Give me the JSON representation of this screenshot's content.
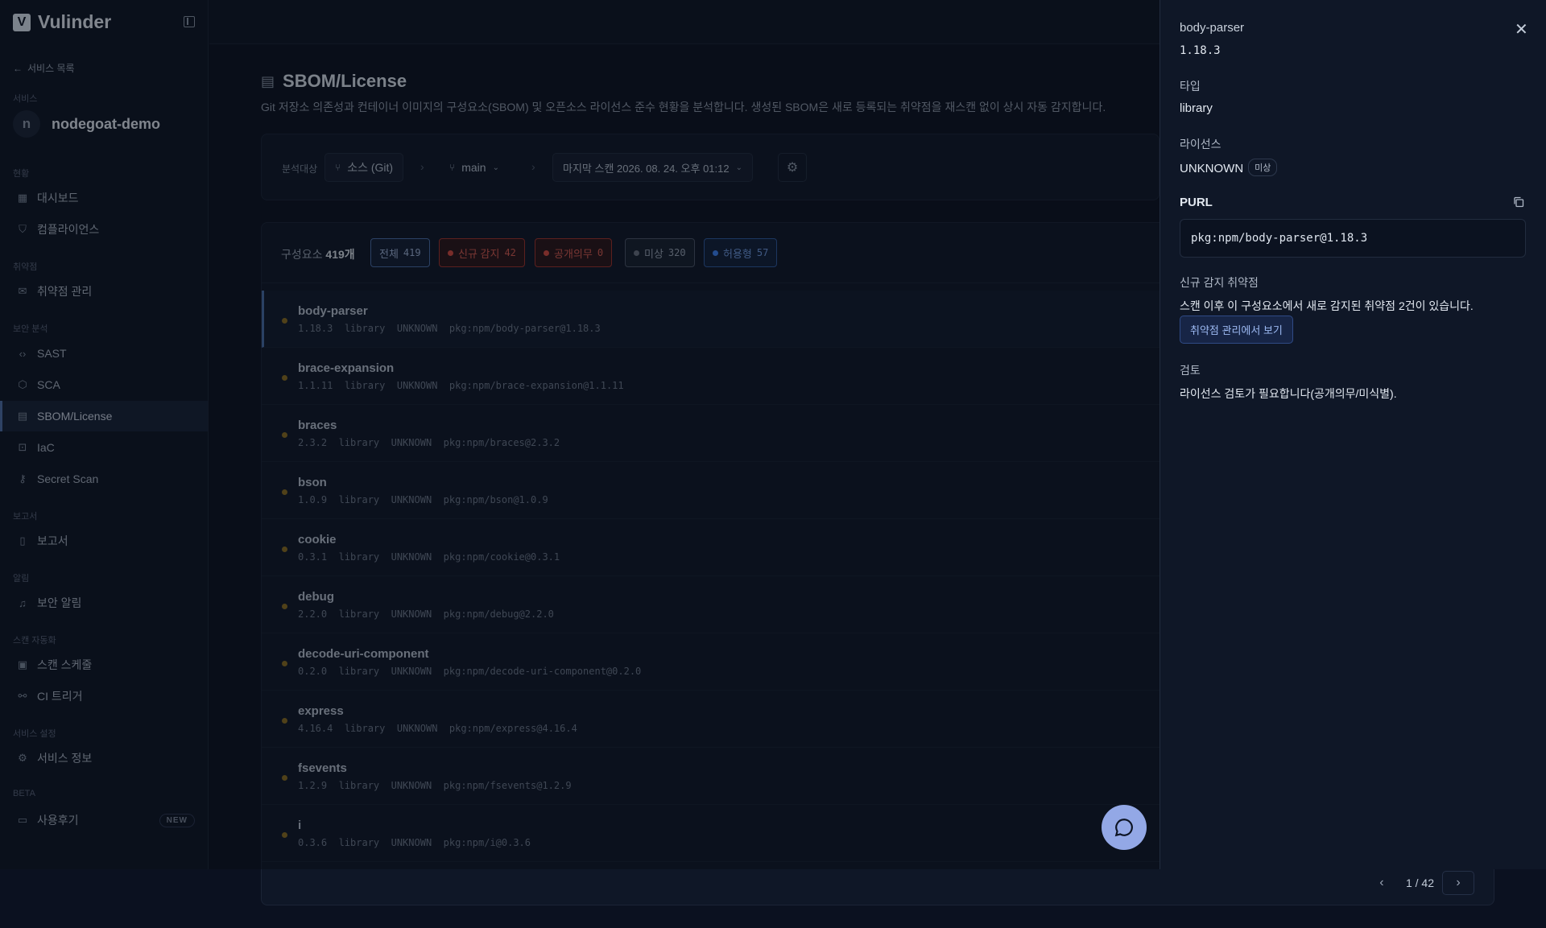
{
  "sidebar": {
    "brand_letter": "V",
    "brand": "Vulinder",
    "back_label": "서비스 목록",
    "service_section": "서비스",
    "service_initial": "n",
    "service_name": "nodegoat-demo",
    "sections": [
      {
        "label": "현황",
        "items": [
          {
            "label": "대시보드",
            "icon": "dashboard-icon"
          },
          {
            "label": "컴플라이언스",
            "icon": "shield-icon"
          }
        ]
      },
      {
        "label": "취약점",
        "items": [
          {
            "label": "취약점 관리",
            "icon": "inbox-icon"
          }
        ]
      },
      {
        "label": "보안 분석",
        "items": [
          {
            "label": "SAST",
            "icon": "code-icon"
          },
          {
            "label": "SCA",
            "icon": "package-icon"
          },
          {
            "label": "SBOM/License",
            "icon": "clipboard-icon"
          },
          {
            "label": "IaC",
            "icon": "scan-icon"
          },
          {
            "label": "Secret Scan",
            "icon": "key-icon"
          }
        ]
      },
      {
        "label": "보고서",
        "items": [
          {
            "label": "보고서",
            "icon": "file-icon"
          }
        ]
      },
      {
        "label": "알림",
        "items": [
          {
            "label": "보안 알림",
            "icon": "bell-icon"
          }
        ]
      },
      {
        "label": "스캔 자동화",
        "items": [
          {
            "label": "스캔 스케줄",
            "icon": "calendar-icon"
          },
          {
            "label": "CI 트리거",
            "icon": "webhook-icon"
          }
        ]
      },
      {
        "label": "서비스 설정",
        "items": [
          {
            "label": "서비스 정보",
            "icon": "gear-icon"
          }
        ]
      },
      {
        "label": "BETA",
        "items": [
          {
            "label": "사용후기",
            "icon": "feedback-icon",
            "badge": "NEW"
          }
        ]
      }
    ]
  },
  "main": {
    "title": "SBOM/License",
    "description": "Git 저장소 의존성과 컨테이너 이미지의 구성요소(SBOM) 및 오픈소스 라이선스 준수 현황을 분석합니다. 생성된 SBOM은 새로 등록되는 취약점을 재스캔 없이 상시 자동 감지합니다.",
    "filter_label": "분석대상",
    "source": "소스 (Git)",
    "branch": "main",
    "last_scan": "마지막 스캔 2026. 08. 24. 오후 01:12",
    "count_prefix": "구성요소",
    "count_value": "419개",
    "filters": [
      {
        "label": "전체",
        "count": "419"
      },
      {
        "label": "신규 감지",
        "count": "42"
      },
      {
        "label": "공개의무",
        "count": "0"
      },
      {
        "label": "미상",
        "count": "320"
      },
      {
        "label": "허용형",
        "count": "57"
      }
    ],
    "rows": [
      {
        "name": "body-parser",
        "version": "1.18.3",
        "type": "library",
        "license": "UNKNOWN",
        "purl": "pkg:npm/body-parser@1.18.3"
      },
      {
        "name": "brace-expansion",
        "version": "1.1.11",
        "type": "library",
        "license": "UNKNOWN",
        "purl": "pkg:npm/brace-expansion@1.1.11"
      },
      {
        "name": "braces",
        "version": "2.3.2",
        "type": "library",
        "license": "UNKNOWN",
        "purl": "pkg:npm/braces@2.3.2"
      },
      {
        "name": "bson",
        "version": "1.0.9",
        "type": "library",
        "license": "UNKNOWN",
        "purl": "pkg:npm/bson@1.0.9"
      },
      {
        "name": "cookie",
        "version": "0.3.1",
        "type": "library",
        "license": "UNKNOWN",
        "purl": "pkg:npm/cookie@0.3.1"
      },
      {
        "name": "debug",
        "version": "2.2.0",
        "type": "library",
        "license": "UNKNOWN",
        "purl": "pkg:npm/debug@2.2.0"
      },
      {
        "name": "decode-uri-component",
        "version": "0.2.0",
        "type": "library",
        "license": "UNKNOWN",
        "purl": "pkg:npm/decode-uri-component@0.2.0"
      },
      {
        "name": "express",
        "version": "4.16.4",
        "type": "library",
        "license": "UNKNOWN",
        "purl": "pkg:npm/express@4.16.4"
      },
      {
        "name": "fsevents",
        "version": "1.2.9",
        "type": "library",
        "license": "UNKNOWN",
        "purl": "pkg:npm/fsevents@1.2.9"
      },
      {
        "name": "i",
        "version": "0.3.6",
        "type": "library",
        "license": "UNKNOWN",
        "purl": "pkg:npm/i@0.3.6"
      }
    ],
    "pager": "1 / 42"
  },
  "drawer": {
    "name": "body-parser",
    "version": "1.18.3",
    "type_label": "타입",
    "type_value": "library",
    "license_label": "라이선스",
    "license_value": "UNKNOWN",
    "license_badge": "미상",
    "purl_label": "PURL",
    "purl_value": "pkg:npm/body-parser@1.18.3",
    "new_vuln_label": "신규 감지 취약점",
    "new_vuln_text": "스캔 이후 이 구성요소에서 새로 감지된 취약점 2건이 있습니다.",
    "vuln_button": "취약점 관리에서 보기",
    "review_label": "검토",
    "review_text": "라이선스 검토가 필요합니다(공개의무/미식별)."
  },
  "colors": {
    "accent": "#4a6da8",
    "new_detect": "#c0392b",
    "unknown": "#6b7280",
    "permissive": "#3b82f6",
    "row_dot": "#8c6d1f",
    "chat_button": "#93a8e6"
  }
}
